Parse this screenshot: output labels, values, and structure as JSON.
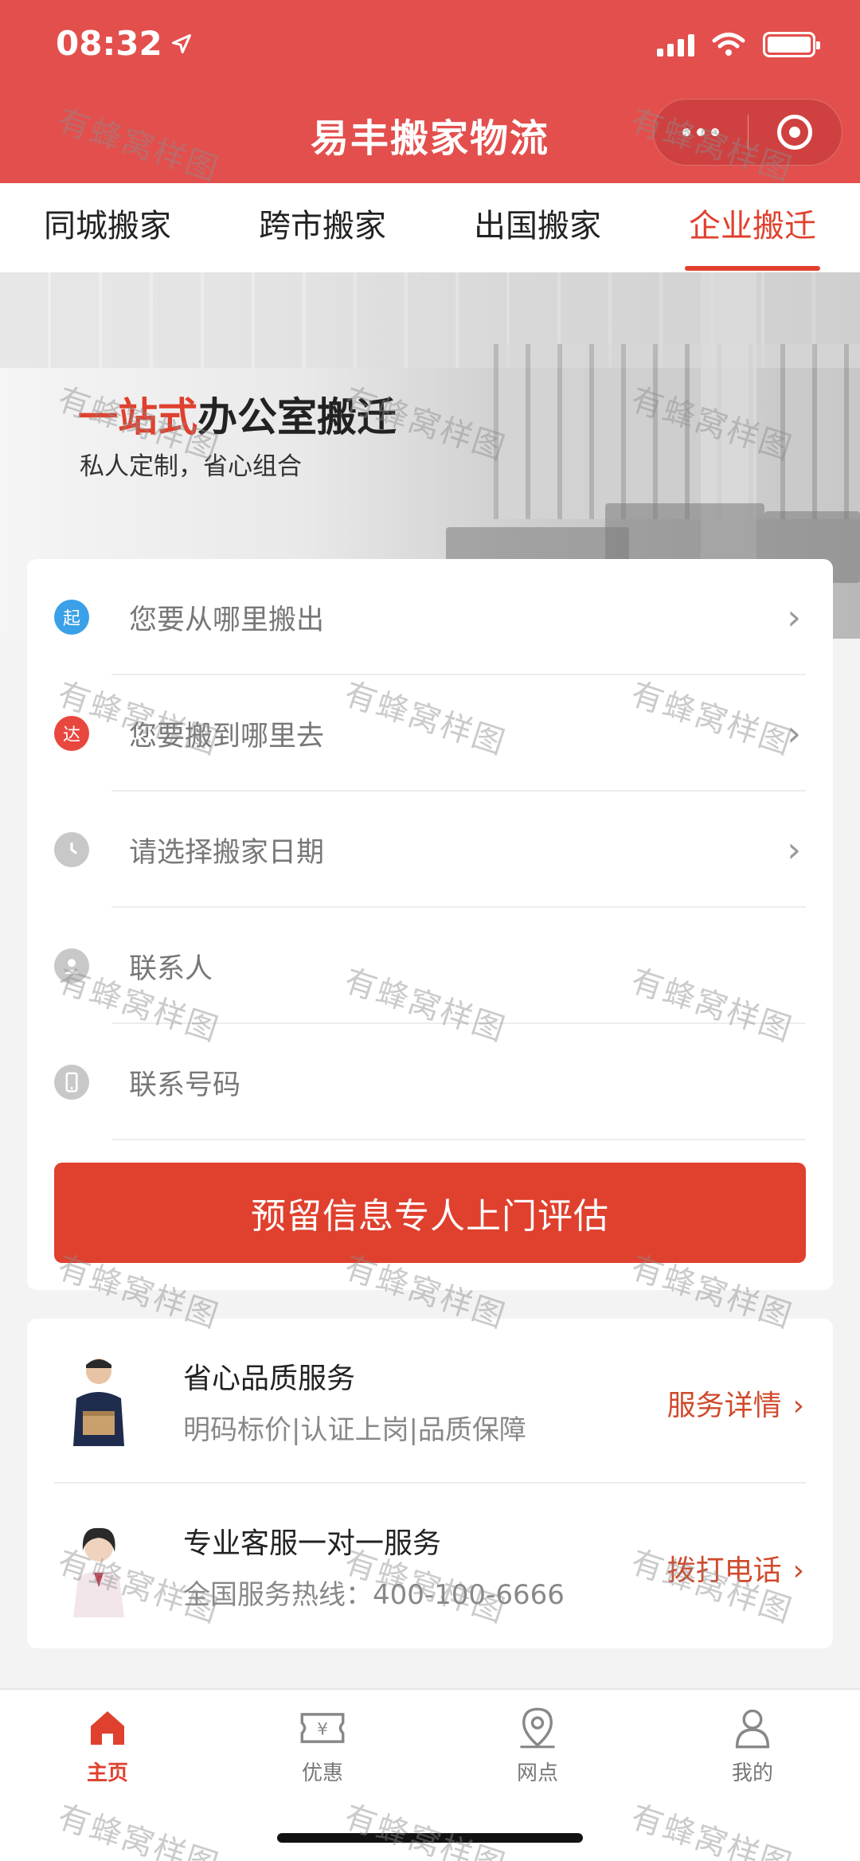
{
  "status_bar": {
    "time": "08:32"
  },
  "nav": {
    "title": "易丰搬家物流"
  },
  "tabs": [
    {
      "label": "同城搬家",
      "active": false
    },
    {
      "label": "跨市搬家",
      "active": false
    },
    {
      "label": "出国搬家",
      "active": false
    },
    {
      "label": "企业搬迁",
      "active": true
    }
  ],
  "banner": {
    "headline_accent": "一站式",
    "headline_rest": "办公室搬迁",
    "subtitle": "私人定制，省心组合"
  },
  "form": {
    "from_placeholder": "您要从哪里搬出",
    "to_placeholder": "您要搬到哪里去",
    "date_placeholder": "请选择搬家日期",
    "contact_placeholder": "联系人",
    "phone_placeholder": "联系号码",
    "start_badge": "起",
    "end_badge": "达",
    "submit_label": "预留信息专人上门评估"
  },
  "services": [
    {
      "title": "省心品质服务",
      "desc": "明码标价|认证上岗|品质保障",
      "link": "服务详情"
    },
    {
      "title": "专业客服一对一服务",
      "desc": "全国服务热线：400-100-6666",
      "link": "拨打电话"
    }
  ],
  "tabbar": [
    {
      "label": "主页",
      "icon": "home-icon",
      "active": true
    },
    {
      "label": "优惠",
      "icon": "coupon-icon",
      "active": false
    },
    {
      "label": "网点",
      "icon": "location-icon",
      "active": false
    },
    {
      "label": "我的",
      "icon": "user-icon",
      "active": false
    }
  ],
  "watermark": "有蜂窝样图",
  "colors": {
    "brand": "#e34f4d",
    "accent": "#e0402e",
    "start": "#3aa0e8",
    "end": "#e8473f"
  }
}
